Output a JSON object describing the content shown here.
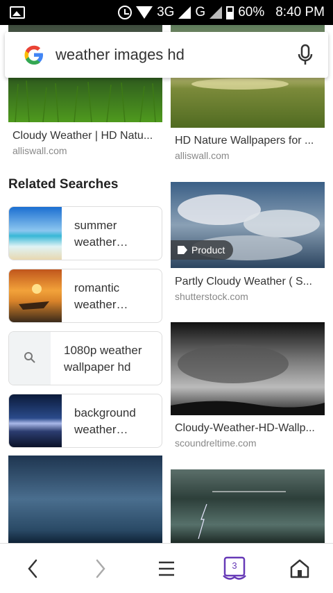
{
  "status": {
    "network1": "3G",
    "network2": "G",
    "battery": "60%",
    "time": "8:40 PM"
  },
  "search": {
    "query": "weather images hd"
  },
  "related": {
    "title": "Related Searches",
    "items": [
      {
        "label": "summer weather…"
      },
      {
        "label": "romantic weather…"
      },
      {
        "label": "1080p weather wallpaper hd"
      },
      {
        "label": "background weather…"
      }
    ]
  },
  "results": [
    {
      "title": "Cloudy Weather | HD Natu...",
      "source": "alliswall.com"
    },
    {
      "title": "HD Nature Wallpapers for ...",
      "source": "alliswall.com"
    },
    {
      "title": "Partly Cloudy Weather ( S...",
      "source": "shutterstock.com",
      "badge": "Product"
    },
    {
      "title": "Cloudy-Weather-HD-Wallp...",
      "source": "scoundreltime.com"
    }
  ],
  "nav": {
    "tabs_count": "3"
  },
  "colors": {
    "accent": "#673ab7"
  }
}
